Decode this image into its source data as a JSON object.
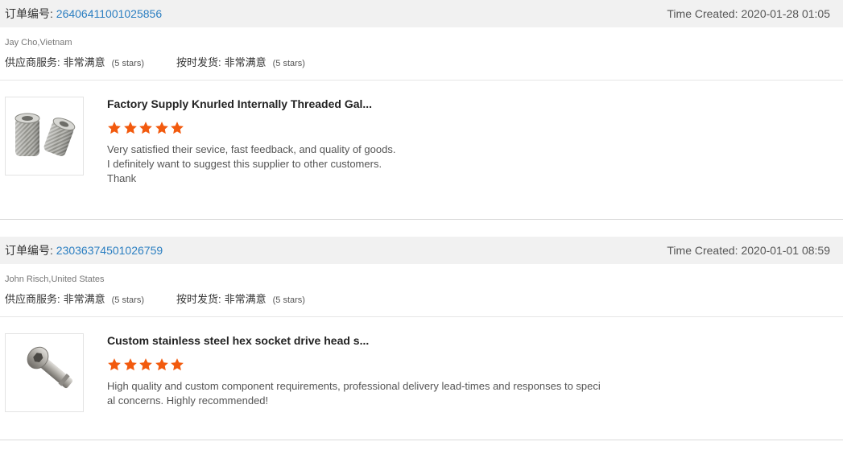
{
  "colors": {
    "link": "#2a7ec1",
    "star": "#f25a0e",
    "bar_bg": "#f1f1f1"
  },
  "reviews": [
    {
      "order_label": "订单编号:",
      "order_number": "26406411001025856",
      "time_created": "Time Created: 2020-01-28 01:05",
      "buyer": "Jay Cho,Vietnam",
      "supplier_service_label": "供应商服务:",
      "supplier_service_value": "非常满意",
      "supplier_service_stars": "(5 stars)",
      "on_time_label": "按时发货:",
      "on_time_value": "非常满意",
      "on_time_stars": "(5 stars)",
      "product_title": "Factory Supply Knurled Internally Threaded Gal...",
      "product_icon": "knurled-nut-image",
      "rating": 5,
      "comment_lines": [
        "Very satisfied their sevice, fast feedback, and quality of goods.",
        "I definitely want to suggest this supplier to other customers.",
        "Thank"
      ]
    },
    {
      "order_label": "订单编号:",
      "order_number": "23036374501026759",
      "time_created": "Time Created: 2020-01-01 08:59",
      "buyer": "John Risch,United States",
      "supplier_service_label": "供应商服务:",
      "supplier_service_value": "非常满意",
      "supplier_service_stars": "(5 stars)",
      "on_time_label": "按时发货:",
      "on_time_value": "非常满意",
      "on_time_stars": "(5 stars)",
      "product_title": "Custom stainless steel hex socket drive head s...",
      "product_icon": "hex-socket-bolt-image",
      "rating": 5,
      "comment_lines": [
        "High quality and custom component requirements, professional delivery lead-times and responses to speci",
        "al concerns. Highly recommended!"
      ]
    }
  ]
}
